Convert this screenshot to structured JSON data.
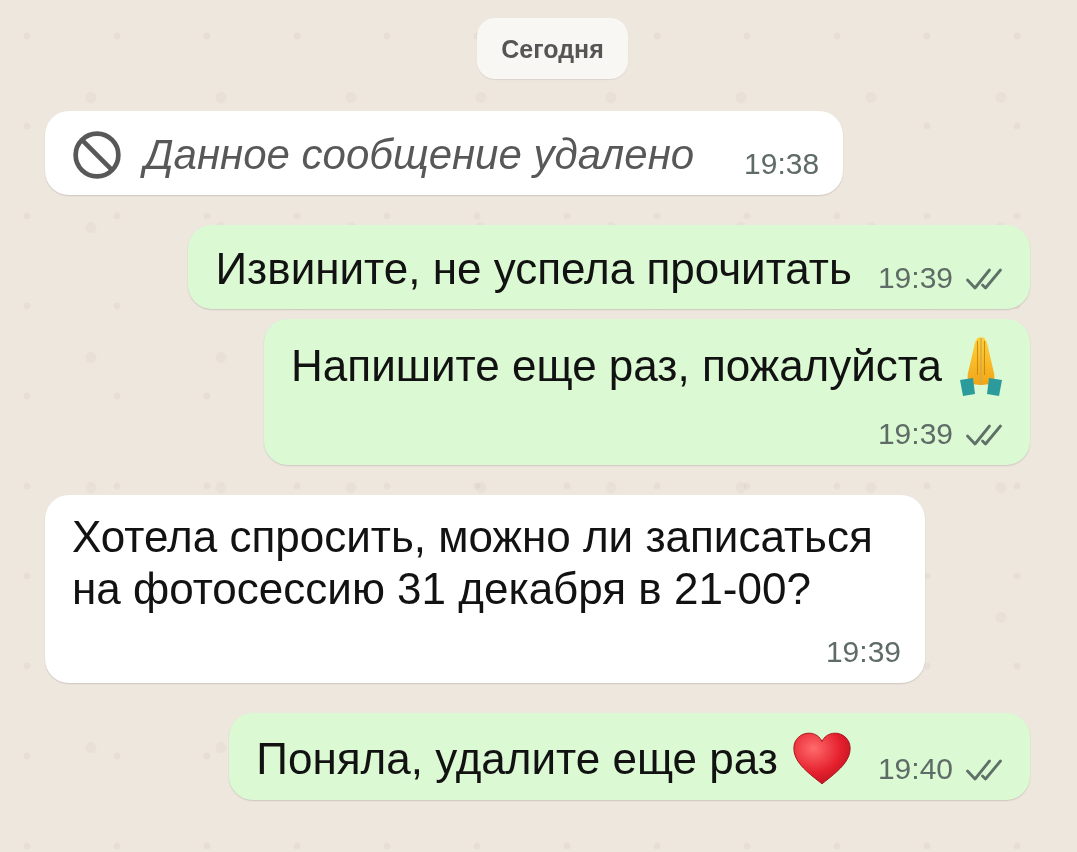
{
  "date_separator": {
    "label": "Сегодня"
  },
  "messages": [
    {
      "kind": "deleted",
      "outgoing": false,
      "text": "Данное сообщение удалено",
      "time": "19:38"
    },
    {
      "kind": "text",
      "outgoing": true,
      "text": "Извините, не успела прочитать",
      "time": "19:39",
      "read": false
    },
    {
      "kind": "text",
      "outgoing": true,
      "text": "Напишите еще раз, пожалуйста",
      "emoji": {
        "kind": "folded-hands"
      },
      "time": "19:39",
      "read": false
    },
    {
      "kind": "text",
      "outgoing": false,
      "text": "Хотела спросить, можно ли записаться на фотосессию 31 декабря в 21-00?",
      "time": "19:39"
    },
    {
      "kind": "text",
      "outgoing": true,
      "text": "Поняла, удалите еще раз",
      "emoji": {
        "kind": "heart"
      },
      "time": "19:40",
      "read": false
    }
  ]
}
